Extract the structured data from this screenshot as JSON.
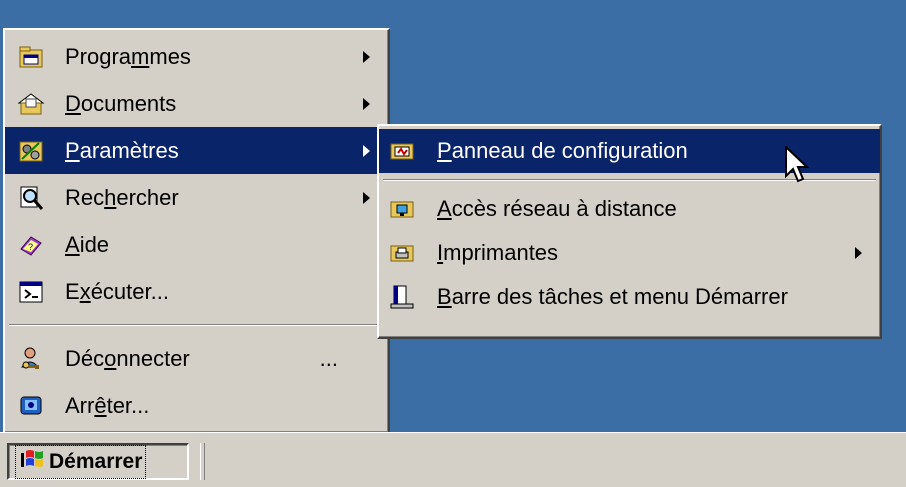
{
  "start_menu": {
    "items": [
      {
        "pre": "Progra",
        "u": "m",
        "post": "mes",
        "icon": "programs-folder-icon"
      },
      {
        "pre": "",
        "u": "D",
        "post": "ocuments",
        "icon": "documents-folder-icon"
      },
      {
        "pre": "",
        "u": "P",
        "post": "aramètres",
        "icon": "settings-icon"
      },
      {
        "pre": "Rec",
        "u": "h",
        "post": "ercher",
        "icon": "search-icon"
      },
      {
        "pre": "",
        "u": "A",
        "post": "ide",
        "icon": "help-book-icon"
      },
      {
        "pre": "E",
        "u": "x",
        "post": "écuter...",
        "icon": "run-icon"
      },
      {
        "pre": "Déc",
        "u": "o",
        "post": "nnecter",
        "extra": "...",
        "icon": "logoff-key-icon"
      },
      {
        "pre": "Arr",
        "u": "ê",
        "post": "ter...",
        "icon": "shutdown-icon"
      }
    ]
  },
  "settings_submenu": {
    "items": [
      {
        "pre": "",
        "u": "P",
        "post": "anneau de configuration",
        "icon": "control-panel-icon"
      },
      {
        "pre": "",
        "u": "A",
        "post": "ccès réseau à distance",
        "icon": "dialup-network-icon"
      },
      {
        "pre": "",
        "u": "I",
        "post": "mprimantes",
        "icon": "printers-icon"
      },
      {
        "pre": "",
        "u": "B",
        "post": "arre des tâches et menu Démarrer",
        "icon": "taskbar-icon"
      }
    ]
  },
  "taskbar": {
    "start_label": "Démarrer"
  },
  "colors": {
    "desktop": "#3a6ea5",
    "menu_face": "#d4d0c8",
    "highlight": "#0a246a"
  }
}
